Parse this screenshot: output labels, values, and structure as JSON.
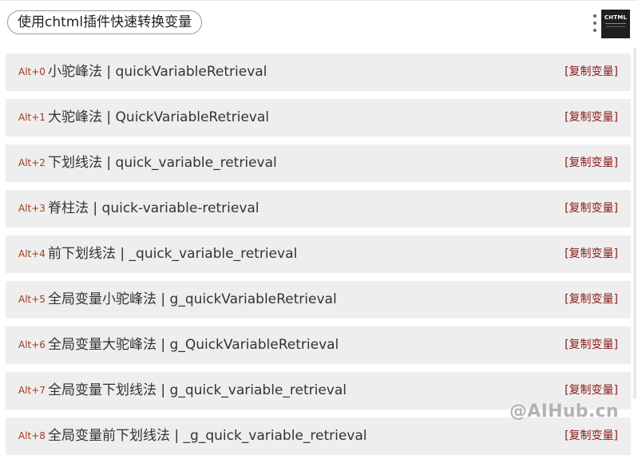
{
  "header": {
    "title": "使用chtml插件快速转换变量",
    "logo_text": "CHTML",
    "menu_icon": "more-vertical-icon"
  },
  "items": [
    {
      "shortcut": "Alt+0",
      "label": "小驼峰法 | quickVariableRetrieval",
      "copy": "[复制变量]"
    },
    {
      "shortcut": "Alt+1",
      "label": "大驼峰法 | QuickVariableRetrieval",
      "copy": "[复制变量]"
    },
    {
      "shortcut": "Alt+2",
      "label": "下划线法 | quick_variable_retrieval",
      "copy": "[复制变量]"
    },
    {
      "shortcut": "Alt+3",
      "label": "脊柱法 | quick-variable-retrieval",
      "copy": "[复制变量]"
    },
    {
      "shortcut": "Alt+4",
      "label": "前下划线法 | _quick_variable_retrieval",
      "copy": "[复制变量]"
    },
    {
      "shortcut": "Alt+5",
      "label": "全局变量小驼峰法 | g_quickVariableRetrieval",
      "copy": "[复制变量]"
    },
    {
      "shortcut": "Alt+6",
      "label": "全局变量大驼峰法 | g_QuickVariableRetrieval",
      "copy": "[复制变量]"
    },
    {
      "shortcut": "Alt+7",
      "label": "全局变量下划线法 | g_quick_variable_retrieval",
      "copy": "[复制变量]"
    },
    {
      "shortcut": "Alt+8",
      "label": "全局变量前下划线法 | _g_quick_variable_retrieval",
      "copy": "[复制变量]"
    }
  ],
  "watermark": "@AIHub.cn",
  "colors": {
    "row_bg": "#eeeeee",
    "shortcut": "#a33a1a",
    "copy_link": "#8b1a1a"
  }
}
